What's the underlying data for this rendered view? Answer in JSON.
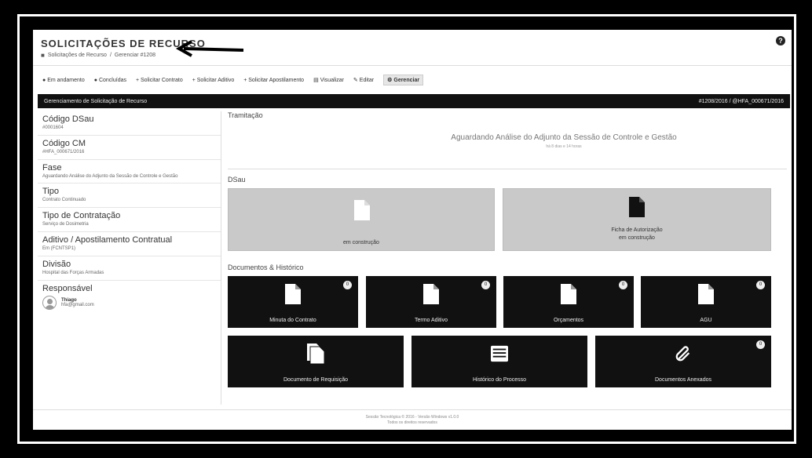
{
  "header": {
    "title": "SOLICITAÇÕES DE RECURSO",
    "breadcrumb": [
      "Solicitações de Recurso",
      "Gerenciar #1208"
    ],
    "help_icon": "question-icon"
  },
  "toolbar": {
    "items": [
      {
        "label": "Em andamento",
        "icon": "circle-icon"
      },
      {
        "label": "Concluídas",
        "icon": "circle-icon"
      },
      {
        "label": "+ Solicitar Contrato",
        "icon": "plus-icon"
      },
      {
        "label": "+ Solicitar Aditivo",
        "icon": "plus-icon"
      },
      {
        "label": "+ Solicitar Apostilamento",
        "icon": "plus-icon"
      },
      {
        "label": "Visualizar",
        "icon": "view-icon"
      },
      {
        "label": "Editar",
        "icon": "pencil-icon"
      },
      {
        "label": "Gerenciar",
        "icon": "gear-icon"
      }
    ]
  },
  "bar": {
    "left": "Gerenciamento de Solicitação de Recurso",
    "right": "#1208/2016 / @HFA_000671/2016"
  },
  "side": {
    "fields": [
      {
        "label": "Código DSau",
        "value": "#0001604"
      },
      {
        "label": "Código CM",
        "value": "#HFA_000671/2016"
      },
      {
        "label": "Fase",
        "value": "Aguardando Análise do Adjunto da Sessão de Controle e Gestão"
      },
      {
        "label": "Tipo",
        "value": "Contrato Continuado"
      },
      {
        "label": "Tipo de Contratação",
        "value": "Serviço de Dosimetria"
      },
      {
        "label": "Aditivo / Apostilamento Contratual",
        "value": "Em (FCNTSP1)"
      },
      {
        "label": "Divisão",
        "value": "Hospital das Forças Armadas"
      }
    ],
    "responsible": {
      "label": "Responsável",
      "name": "Thiago",
      "email": "hfa@gmail.com"
    }
  },
  "tramitacao": {
    "title": "Tramitação",
    "status": "Aguardando Análise do Adjunto da Sessão de Controle e Gestão",
    "sub": "há 8 dias e 14 horas"
  },
  "dsau": {
    "title": "DSau",
    "left_caption": "em construção",
    "right_caption_1": "Ficha de Autorização",
    "right_caption_2": "em construção"
  },
  "docs": {
    "title": "Documentos & Histórico",
    "tiles": [
      {
        "label": "Minuta do Contrato",
        "count": "0"
      },
      {
        "label": "Termo Aditivo",
        "count": "0"
      },
      {
        "label": "Orçamentos",
        "count": "0"
      },
      {
        "label": "AGU",
        "count": "0"
      },
      {
        "label": "Documento de Requisição",
        "count": ""
      },
      {
        "label": "Histórico do Processo",
        "count": ""
      },
      {
        "label": "Documentos Anexados",
        "count": "0"
      }
    ]
  },
  "footer": {
    "line1": "Sessão Tecnológica © 2016 - Versão Windows v1.0.0",
    "line2": "Todos os direitos reservados"
  }
}
